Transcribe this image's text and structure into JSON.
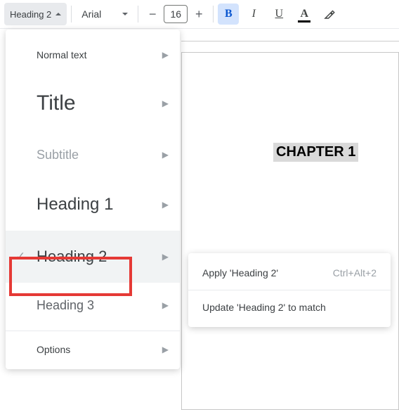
{
  "toolbar": {
    "style_selected": "Heading 2",
    "font_selected": "Arial",
    "font_size": "16",
    "minus": "−",
    "plus": "+",
    "bold": "B",
    "italic": "I",
    "underline": "U",
    "textcolor": "A"
  },
  "dropdown": {
    "items": [
      {
        "label": "Normal text",
        "cls": "dd-normal"
      },
      {
        "label": "Title",
        "cls": "dd-title"
      },
      {
        "label": "Subtitle",
        "cls": "dd-subtitle"
      },
      {
        "label": "Heading 1",
        "cls": "dd-h1"
      },
      {
        "label": "Heading 2",
        "cls": "dd-h2",
        "checked": true,
        "hover": true,
        "highlight": true
      },
      {
        "label": "Heading 3",
        "cls": "dd-h3"
      }
    ],
    "options_label": "Options"
  },
  "submenu": {
    "apply_label": "Apply 'Heading 2'",
    "apply_shortcut": "Ctrl+Alt+2",
    "update_label": "Update 'Heading 2' to match"
  },
  "document": {
    "selected_text": "CHAPTER 1"
  }
}
